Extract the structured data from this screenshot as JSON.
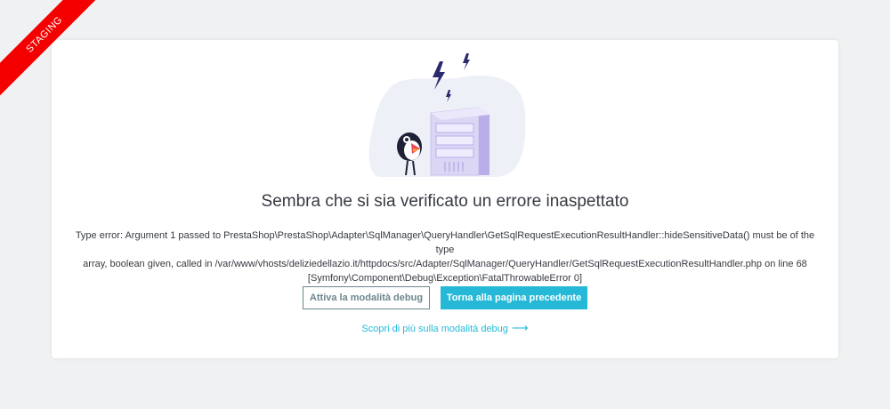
{
  "ribbon": {
    "label": "STAGING",
    "color": "#f40000"
  },
  "page": {
    "title": "Sembra che si sia verificato un errore inaspettato",
    "error_lines": [
      "Type error: Argument 1 passed to PrestaShop\\PrestaShop\\Adapter\\SqlManager\\QueryHandler\\GetSqlRequestExecutionResultHandler::hideSensitiveData() must be of the type",
      "array, boolean given, called in /var/www/vhosts/deliziedellazio.it/httpdocs/src/Adapter/SqlManager/QueryHandler/GetSqlRequestExecutionResultHandler.php on line 68",
      "[Symfony\\Component\\Debug\\Exception\\FatalThrowableError 0]"
    ],
    "buttons": {
      "debug_label": "Attiva la modalità debug",
      "back_label": "Torna alla pagina precedente"
    },
    "learn_more": {
      "label": "Scopri di più sulla modalità debug",
      "icon": "arrow-right-icon"
    }
  },
  "illustration": {
    "icon": "server-with-puffin-illustration"
  },
  "colors": {
    "accent": "#25b9d7",
    "text": "#363a41",
    "secondary": "#6c868e",
    "background": "#eff1f2"
  }
}
